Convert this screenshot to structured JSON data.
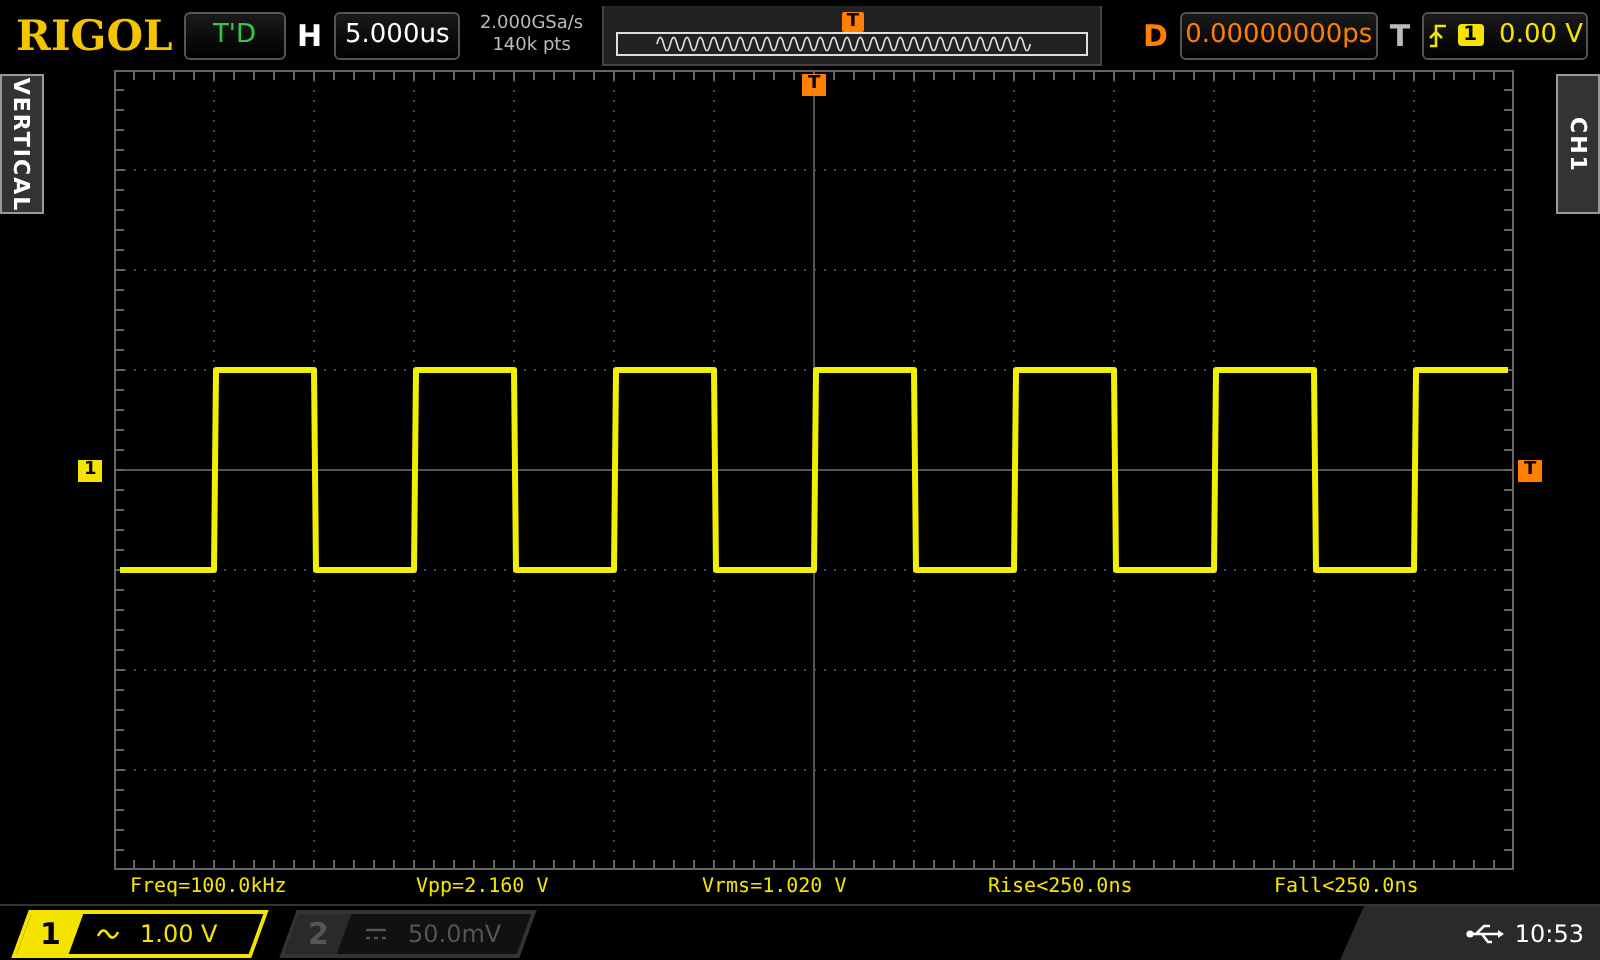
{
  "top_bar": {
    "logo": "RIGOL",
    "status": "T'D",
    "horizontal_label": "H",
    "timebase": "5.000us",
    "sample_rate": "2.000GSa/s",
    "memory_depth": "140k pts",
    "memory_trigger_marker": "T",
    "delay_label": "D",
    "delay": "0.00000000ps",
    "trigger_label": "T",
    "trigger_source": "1",
    "trigger_level": "0.00 V"
  },
  "side_tabs": {
    "left": "VERTICAL",
    "right": "CH1"
  },
  "screen": {
    "trigger_position_marker": "T",
    "channel_marker": "1",
    "trigger_level_marker": "T"
  },
  "measurements": [
    "Freq=100.0kHz",
    "Vpp=2.160 V",
    "Vrms=1.020 V",
    "Rise<250.0ns",
    "Fall<250.0ns"
  ],
  "channels": [
    {
      "label": "1",
      "kind": "ac",
      "scale": "1.00 V",
      "on": true
    },
    {
      "label": "2",
      "kind": "dc",
      "scale": "50.0mV",
      "on": false
    }
  ],
  "status_bar": {
    "time": "10:53"
  }
}
